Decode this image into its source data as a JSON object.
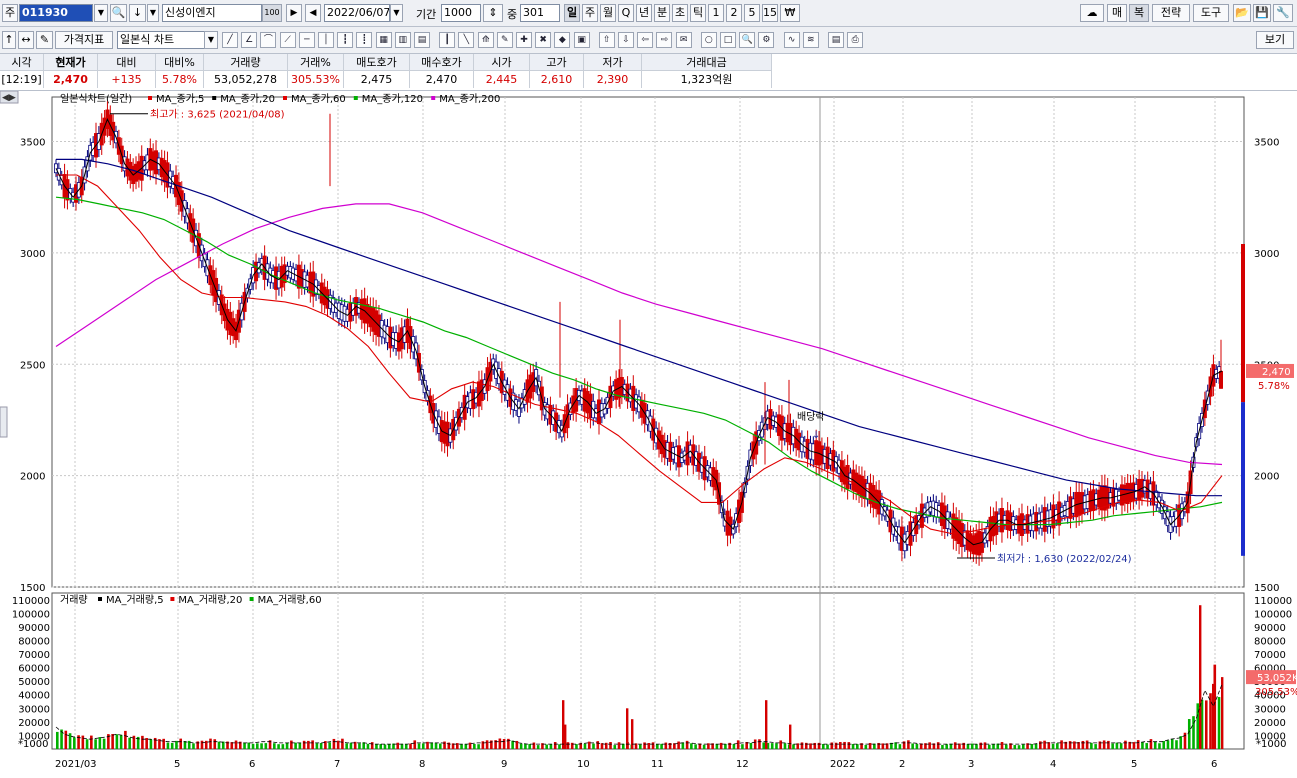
{
  "toolbar1": {
    "market_label": "주",
    "code": "011930",
    "name": "신성이엔지",
    "name_badge": "100",
    "date": "2022/06/07",
    "period_label": "기간",
    "period_value": "1000",
    "count_label": "중",
    "count_value": "301",
    "period_tabs": [
      "일",
      "주",
      "월",
      "Q",
      "년",
      "분",
      "초",
      "틱",
      "1",
      "2",
      "5",
      "15",
      "₩"
    ],
    "right_buttons": [
      "매",
      "복",
      "전략",
      "도구"
    ]
  },
  "toolbar2": {
    "indicator_button": "가격지표",
    "chart_type": "일본식 차트",
    "view_button": "보기"
  },
  "quote": {
    "headers": [
      "시각",
      "현재가",
      "대비",
      "대비%",
      "거래량",
      "거래%",
      "매도호가",
      "매수호가",
      "시가",
      "고가",
      "저가",
      "거래대금"
    ],
    "values": [
      "[12:19]",
      "2,470",
      "+135",
      "5.78%",
      "53,052,278",
      "305.53%",
      "2,475",
      "2,470",
      "2,445",
      "2,610",
      "2,390",
      "1,323억원"
    ]
  },
  "chart": {
    "title": "일본식차트(일간)",
    "legend": [
      {
        "name": "MA_종가,5",
        "color": "#e00000"
      },
      {
        "name": "MA_종가,20",
        "color": "#000000"
      },
      {
        "name": "MA_종가,60",
        "color": "#e00000"
      },
      {
        "name": "MA_종가,120",
        "color": "#00b000"
      },
      {
        "name": "MA_종가,200",
        "color": "#d000d0"
      }
    ],
    "annot_high": "최고가 : 3,625 (2021/04/08)",
    "annot_low": "최저가 : 1,630 (2022/02/24)",
    "annot_div": "배당락",
    "price_badge": "2,470",
    "pct_badge": "5.78%",
    "volume_title": "거래량",
    "volume_legend": [
      {
        "name": "MA_거래량,5",
        "color": "#000000"
      },
      {
        "name": "MA_거래량,20",
        "color": "#e00000"
      },
      {
        "name": "MA_거래량,60",
        "color": "#00b000"
      }
    ],
    "vol_badge": "53,052K",
    "vol_pct_badge": "305.53%",
    "vol_unit": "*1000"
  },
  "chart_data": {
    "type": "candlestick",
    "price_axis": {
      "ticks": [
        1500,
        2000,
        2500,
        3000,
        3500
      ],
      "range": [
        1500,
        3700
      ]
    },
    "volume_axis": {
      "ticks": [
        0,
        10000,
        20000,
        30000,
        40000,
        50000,
        60000,
        70000,
        80000,
        90000,
        100000,
        110000
      ],
      "unit": "*1000"
    },
    "x_labels": [
      "2021/03",
      "5",
      "6",
      "7",
      "8",
      "9",
      "10",
      "11",
      "12",
      "2022",
      "2",
      "3",
      "4",
      "5",
      "6"
    ],
    "close_series": [
      3380,
      3300,
      3250,
      3300,
      3450,
      3500,
      3600,
      3520,
      3400,
      3350,
      3380,
      3420,
      3400,
      3350,
      3300,
      3200,
      3100,
      3000,
      2900,
      2800,
      2700,
      2650,
      2780,
      2900,
      2950,
      2900,
      2880,
      2920,
      2900,
      2880,
      2860,
      2820,
      2780,
      2740,
      2720,
      2760,
      2740,
      2700,
      2660,
      2620,
      2600,
      2650,
      2560,
      2400,
      2280,
      2200,
      2180,
      2260,
      2330,
      2350,
      2400,
      2500,
      2420,
      2350,
      2300,
      2380,
      2440,
      2300,
      2260,
      2200,
      2300,
      2360,
      2330,
      2280,
      2300,
      2380,
      2400,
      2360,
      2320,
      2260,
      2180,
      2120,
      2100,
      2080,
      2110,
      2060,
      2020,
      1980,
      1800,
      1760,
      1880,
      2080,
      2180,
      2260,
      2240,
      2200,
      2180,
      2140,
      2110,
      2100,
      2080,
      2060,
      2000,
      1980,
      1950,
      1920,
      1880,
      1820,
      1750,
      1700,
      1760,
      1820,
      1860,
      1840,
      1800,
      1760,
      1720,
      1690,
      1700,
      1760,
      1800,
      1800,
      1780,
      1780,
      1790,
      1800,
      1810,
      1830,
      1850,
      1870,
      1880,
      1890,
      1900,
      1900,
      1910,
      1920,
      1930,
      1950,
      1920,
      1860,
      1780,
      1820,
      1880,
      2150,
      2300,
      2450,
      2470
    ],
    "ma": [
      {
        "name": "MA_종가,5",
        "color": "#000080"
      },
      {
        "name": "MA_종가,20",
        "color": "#e00000"
      },
      {
        "name": "MA_종가,60",
        "color": "#00b000"
      },
      {
        "name": "MA_종가,120",
        "color": "#000080"
      },
      {
        "name": "MA_종가,200",
        "color": "#d000d0"
      }
    ],
    "ma_values": {
      "ma60": [
        3250,
        3240,
        3220,
        3200,
        3180,
        3150,
        3100,
        3050,
        2990,
        2950,
        2900,
        2860,
        2820,
        2790,
        2770,
        2750,
        2720,
        2690,
        2650,
        2620,
        2580,
        2540,
        2500,
        2460,
        2430,
        2390,
        2360,
        2340,
        2320,
        2300,
        2280,
        2250,
        2200,
        2150,
        2080,
        2020,
        1970,
        1920,
        1880,
        1850,
        1830,
        1810,
        1800,
        1790,
        1780,
        1780,
        1780,
        1790,
        1800,
        1820,
        1830,
        1840,
        1850,
        1860,
        1880
      ],
      "ma120": [
        3420,
        3420,
        3400,
        3370,
        3330,
        3290,
        3250,
        3200,
        3150,
        3100,
        3060,
        3020,
        2980,
        2940,
        2900,
        2860,
        2820,
        2780,
        2740,
        2700,
        2660,
        2620,
        2580,
        2540,
        2500,
        2460,
        2420,
        2380,
        2340,
        2300,
        2260,
        2220,
        2190,
        2160,
        2130,
        2100,
        2070,
        2040,
        2010,
        1980,
        1960,
        1940,
        1930,
        1920,
        1910,
        1910
      ],
      "ma200": [
        2580,
        2680,
        2780,
        2880,
        2960,
        3040,
        3110,
        3160,
        3200,
        3220,
        3220,
        3180,
        3120,
        3060,
        3000,
        2940,
        2880,
        2820,
        2770,
        2730,
        2690,
        2650,
        2610,
        2570,
        2520,
        2470,
        2420,
        2370,
        2320,
        2270,
        2220,
        2170,
        2130,
        2090,
        2060,
        2050
      ],
      "ma20": [
        3350,
        3350,
        3300,
        3200,
        3100,
        2980,
        2880,
        2820,
        2800,
        2800,
        2790,
        2780,
        2760,
        2720,
        2660,
        2580,
        2460,
        2350,
        2330,
        2390,
        2420,
        2400,
        2360,
        2320,
        2300,
        2280,
        2240,
        2180,
        2100,
        2020,
        1950,
        1880,
        1880,
        1960,
        2030,
        2080,
        2060,
        2020,
        1980,
        1940,
        1890,
        1820,
        1760,
        1740,
        1750,
        1770,
        1780,
        1790,
        1800,
        1820,
        1850,
        1880,
        1890,
        1880,
        1840,
        1880,
        2000
      ]
    },
    "volume_series": [
      18,
      12,
      10,
      9,
      8,
      9,
      10,
      12,
      11,
      9,
      8,
      8,
      7,
      6,
      6,
      6,
      5,
      5,
      6,
      6,
      5,
      5,
      5,
      5,
      6,
      6,
      5,
      5,
      5,
      5,
      5,
      5,
      6,
      6,
      5,
      5,
      5,
      4,
      4,
      4,
      4,
      4,
      5,
      5,
      5,
      5,
      4,
      4,
      4,
      5,
      5,
      6,
      6,
      7,
      5,
      4,
      4,
      4,
      4,
      4,
      4,
      4,
      5,
      5,
      4,
      4,
      4,
      4,
      4,
      4,
      4,
      4,
      4,
      5,
      5,
      4,
      4,
      4,
      4,
      4,
      5,
      5,
      6,
      6,
      5,
      5,
      4,
      4,
      4,
      4,
      4,
      4,
      4,
      4,
      4,
      4,
      4,
      4,
      5,
      5,
      5,
      4,
      4,
      4,
      4,
      4,
      4,
      4,
      4,
      4,
      4,
      4,
      4,
      4,
      4,
      5,
      5,
      5,
      5,
      5,
      5,
      5,
      5,
      5,
      5,
      5,
      5,
      6,
      6,
      6,
      8,
      9,
      12,
      25,
      48,
      35,
      53
    ],
    "volume_spikes": [
      [
        86,
        36
      ],
      [
        86,
        18
      ],
      [
        92,
        22
      ],
      [
        95,
        26
      ],
      [
        118,
        17
      ],
      [
        120,
        15
      ],
      [
        150,
        100
      ],
      [
        155,
        15
      ],
      [
        163,
        36
      ],
      [
        200,
        10
      ]
    ]
  }
}
